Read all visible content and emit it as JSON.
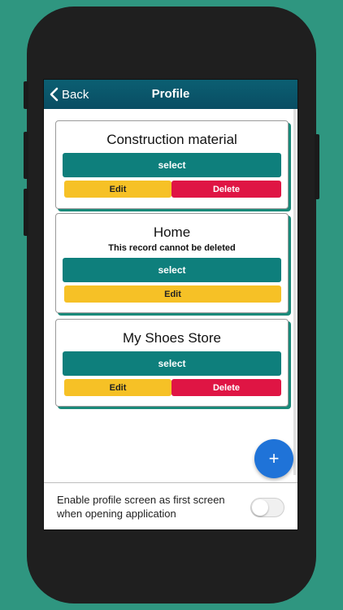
{
  "header": {
    "back_label": "Back",
    "title": "Profile"
  },
  "profiles": [
    {
      "name": "Construction material",
      "note": "",
      "select_label": "select",
      "edit_label": "Edit",
      "delete_label": "Delete"
    },
    {
      "name": "Home",
      "note": "This record cannot be deleted",
      "select_label": "select",
      "edit_label": "Edit",
      "delete_label": ""
    },
    {
      "name": "My Shoes Store",
      "note": "",
      "select_label": "select",
      "edit_label": "Edit",
      "delete_label": "Delete"
    }
  ],
  "fab": {
    "icon": "plus-icon",
    "label": "+"
  },
  "footer": {
    "text": "Enable profile screen as first screen when opening application",
    "toggle_on": false
  },
  "colors": {
    "background": "#2f9680",
    "header": "#0a4d63",
    "select": "#0e7f7c",
    "edit": "#f6c126",
    "delete": "#df1544",
    "fab": "#1f73d8"
  }
}
